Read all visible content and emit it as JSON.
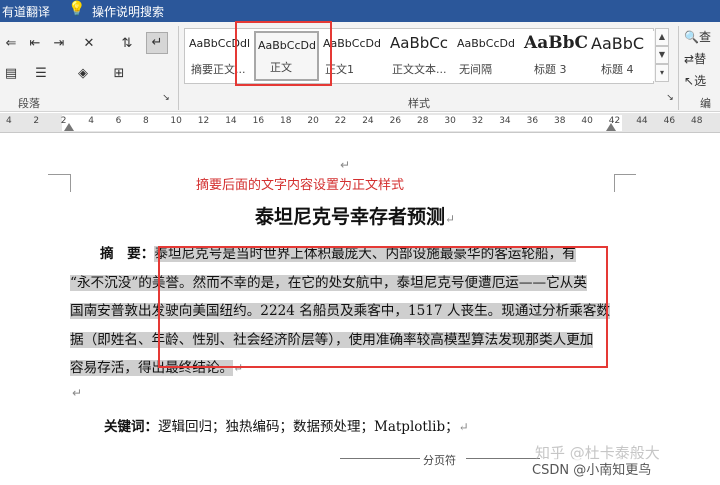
{
  "titlebar": {
    "app_name": "有道翻译",
    "tell_me": "操作说明搜索"
  },
  "ribbon": {
    "paragraph_group_label": "段落",
    "styles_group_label": "样式",
    "editing_group": {
      "find": "查",
      "replace": "替",
      "select": "选",
      "label": "编"
    },
    "styles": [
      {
        "sample": "AaBbCcDdl",
        "name": "摘要正文..."
      },
      {
        "sample": "AaBbCcDd",
        "name": "正文",
        "selected": true
      },
      {
        "sample": "AaBbCcDd",
        "name": "正文1"
      },
      {
        "sample": "AaBbCc",
        "name": "正文文本..."
      },
      {
        "sample": "AaBbCcDd",
        "name": "无间隔"
      },
      {
        "sample": "AaBbC",
        "name": "标题 3"
      },
      {
        "sample": "AaBbC",
        "name": "标题 4"
      }
    ]
  },
  "ruler": {
    "ticks": [
      "4",
      "2",
      "2",
      "4",
      "6",
      "8",
      "10",
      "12",
      "14",
      "16",
      "18",
      "20",
      "22",
      "24",
      "26",
      "28",
      "30",
      "32",
      "34",
      "36",
      "38",
      "40",
      "42",
      "44",
      "46",
      "48"
    ]
  },
  "document": {
    "annotation": "摘要后面的文字内容设置为正文样式",
    "title": "泰坦尼克号幸存者预测",
    "paragraph_mark": "↵",
    "abstract_label": "摘　要：",
    "abstract_lines": [
      "泰坦尼克号是当时世界上体积最庞大、内部设施最豪华的客运轮船，有",
      "“永不沉没”的美誉。然而不幸的是，在它的处女航中，泰坦尼克号便遭厄运——它从英",
      "国南安普敦出发驶向美国纽约。2224 名船员及乘客中，1517 人丧生。现通过分析乘客数",
      "据（即姓名、年龄、性别、社会经济阶层等），使用准确率较高模型算法发现那类人更加",
      "容易存活，得出最终结论。"
    ],
    "keywords_label": "关键词：",
    "keywords": "逻辑回归；独热编码；数据预处理；Matplotlib；",
    "page_break": "分页符"
  },
  "watermark": {
    "line1": "知乎 @杜卡泰般大",
    "line2": "CSDN @小南知更鸟"
  }
}
